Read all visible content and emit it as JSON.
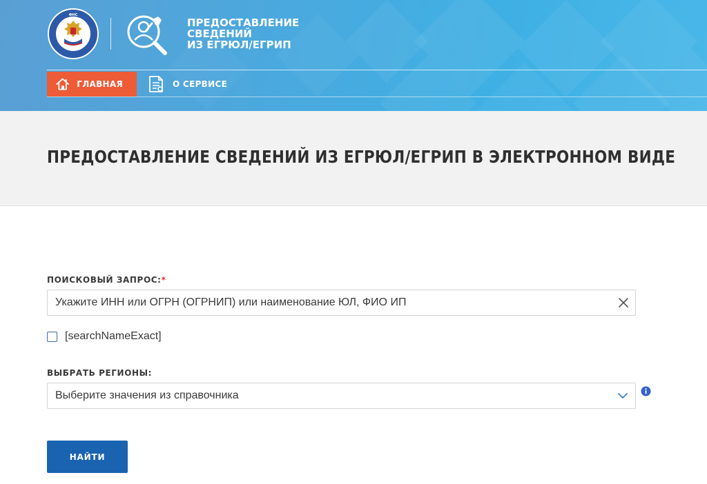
{
  "header": {
    "service_title_lines": [
      "ПРЕДОСТАВЛЕНИЕ",
      "СВЕДЕНИЙ",
      "ИЗ ЕГРЮЛ/ЕГРИП"
    ],
    "logo_icon": "fns-emblem-icon",
    "service_icon": "service-person-wrench-icon"
  },
  "nav": {
    "home": {
      "label": "ГЛАВНАЯ",
      "icon": "home-icon"
    },
    "about": {
      "label": "О СЕРВИСЕ",
      "icon": "document-icon"
    }
  },
  "page": {
    "title": "ПРЕДОСТАВЛЕНИЕ СВЕДЕНИЙ ИЗ ЕГРЮЛ/ЕГРИП В ЭЛЕКТРОННОМ ВИДЕ"
  },
  "form": {
    "search_label": "ПОИСКОВЫЙ ЗАПРОС:",
    "search_required_mark": "*",
    "search_placeholder": "Укажите ИНН или ОГРН (ОГРНИП) или наименование ЮЛ, ФИО ИП",
    "search_value": "",
    "exact_checkbox_label": "[searchNameExact]",
    "exact_checked": false,
    "region_label": "ВЫБРАТЬ РЕГИОНЫ:",
    "region_placeholder": "Выберите значения из справочника",
    "submit_label": "НАЙТИ"
  },
  "colors": {
    "header_blue": "#4aa9de",
    "nav_active": "#ee5b37",
    "button_blue": "#1a63b0",
    "required_red": "#e4342c",
    "info_blue": "#3562c4"
  }
}
